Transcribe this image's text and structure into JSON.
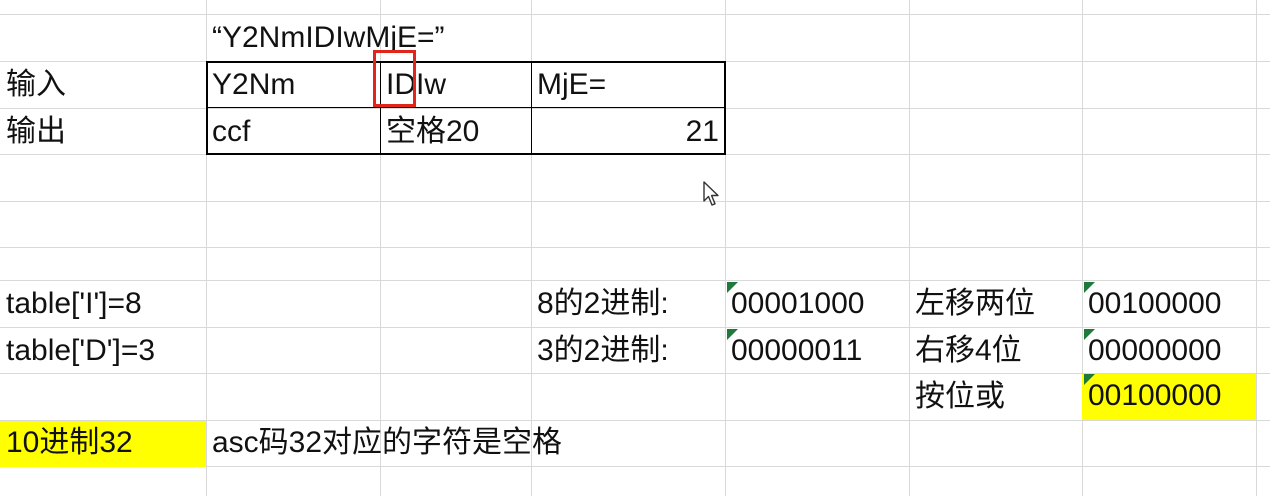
{
  "sheet": {
    "title_string": "“Y2NmIDIwMjE=”",
    "input_label": "输入",
    "output_label": "输出",
    "inputs": [
      "Y2Nm",
      "IDIw",
      "MjE="
    ],
    "outputs": [
      "ccf",
      "空格20",
      "21"
    ],
    "table_I": "table['I']=8",
    "table_D": "table['D']=3",
    "bin8_label": "8的2进制:",
    "bin8_value": "00001000",
    "bin3_label": "3的2进制:",
    "bin3_value": "00000011",
    "shift_left_label": "左移两位",
    "shift_left_value": "00100000",
    "shift_right_label": "右移4位",
    "shift_right_value": "00000000",
    "bitor_label": "按位或",
    "bitor_value": "00100000",
    "dec_label": "10进制32",
    "ascii_note": "asc码32对应的字符是空格"
  },
  "colors": {
    "highlight": "#ffff00",
    "annotation_box": "#e0261b",
    "gridline": "#d9d9d9",
    "text_number_marker": "#1e7a3a"
  },
  "icons": [
    "mouse-pointer-icon"
  ]
}
